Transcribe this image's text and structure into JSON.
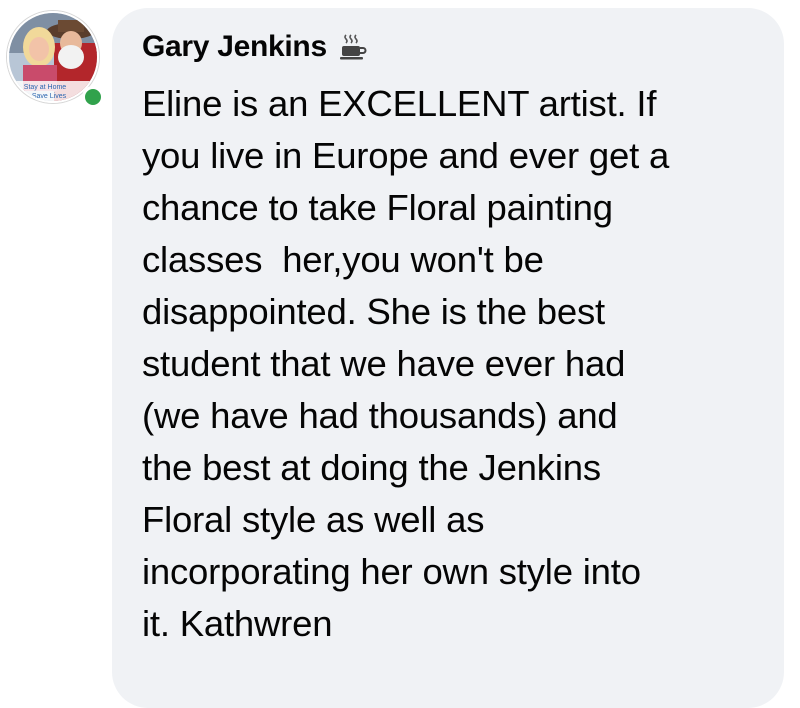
{
  "comment": {
    "author": "Gary Jenkins",
    "author_badge_icon": "coffee-cup-icon",
    "avatar_caption_line1": "Stay at Home",
    "avatar_caption_line2": "Save Lives",
    "presence_status_color": "#31a24c",
    "bubble_color": "#f0f2f5",
    "text": "Eline is an EXCELLENT artist. If\nyou live in Europe and ever get a\nchance to take Floral painting\nclasses  her,you won't be\ndisappointed. She is the best\nstudent that we have ever had\n(we have had thousands) and\nthe best at doing the Jenkins\nFloral style as well as\nincorporating her own style into\nit. Kathwren"
  }
}
